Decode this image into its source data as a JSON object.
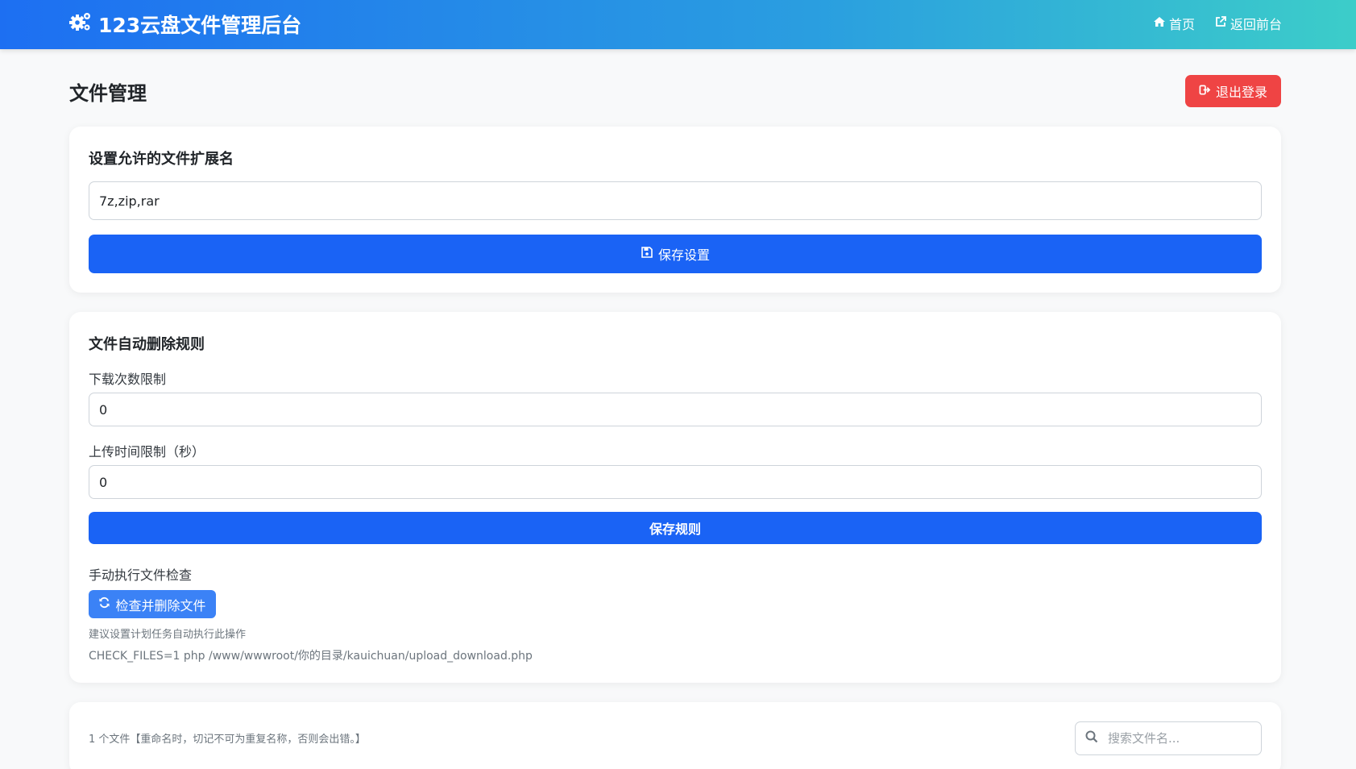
{
  "header": {
    "brand": "123云盘文件管理后台",
    "nav": [
      {
        "label": "首页",
        "icon": "home-icon"
      },
      {
        "label": "返回前台",
        "icon": "external-link-icon"
      }
    ]
  },
  "page": {
    "title": "文件管理",
    "logout_label": "退出登录"
  },
  "extensions": {
    "title": "设置允许的文件扩展名",
    "value": "7z,zip,rar",
    "save_label": "保存设置"
  },
  "auto_delete": {
    "title": "文件自动删除规则",
    "download_limit_label": "下载次数限制",
    "download_limit_value": "0",
    "upload_time_label": "上传时间限制（秒）",
    "upload_time_value": "0",
    "save_label": "保存规则",
    "manual_label": "手动执行文件检查",
    "check_label": "检查并删除文件",
    "hint": "建议设置计划任务自动执行此操作",
    "command": "CHECK_FILES=1 php /www/wwwroot/你的目录/kauichuan/upload_download.php"
  },
  "files": {
    "count_text": "1 个文件【重命名时，切记不可为重复名称，否则会出错。】",
    "search_placeholder": "搜索文件名..."
  },
  "colors": {
    "primary": "#1a63f5",
    "danger": "#ef4444",
    "info": "#3b82f6",
    "header_gradient_start": "#1d6ff2",
    "header_gradient_end": "#3ccdc9"
  }
}
